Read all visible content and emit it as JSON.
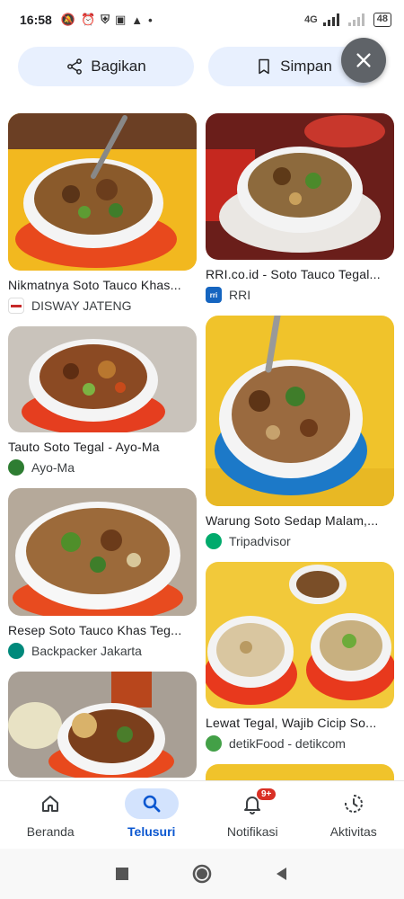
{
  "status_bar": {
    "time": "16:58",
    "network": "4G",
    "battery": "48"
  },
  "actions": {
    "share_label": "Bagikan",
    "save_label": "Simpan"
  },
  "results": {
    "left": [
      {
        "title": "Nikmatnya Soto Tauco Khas...",
        "source": "DISWAY JATENG",
        "favicon_color": "#c62828"
      },
      {
        "title": "Tauto Soto Tegal - Ayo-Ma",
        "source": "Ayo-Ma",
        "favicon_color": "#2e7d32"
      },
      {
        "title": "Resep Soto Tauco Khas Teg...",
        "source": "Backpacker Jakarta",
        "favicon_color": "#00897b"
      },
      {
        "title": "",
        "source": "",
        "favicon_color": "#ffffff"
      }
    ],
    "right": [
      {
        "title": "RRI.co.id - Soto Tauco Tegal...",
        "source": "RRI",
        "favicon_color": "#1565c0"
      },
      {
        "title": "Warung Soto Sedap Malam,...",
        "source": "Tripadvisor",
        "favicon_color": "#00aa6c"
      },
      {
        "title": "Lewat Tegal, Wajib Cicip So...",
        "source": "detikFood - detikcom",
        "favicon_color": "#43a047"
      }
    ]
  },
  "bottom_nav": {
    "items": [
      {
        "label": "Beranda",
        "icon": "home-icon"
      },
      {
        "label": "Telusuri",
        "icon": "search-icon"
      },
      {
        "label": "Notifikasi",
        "icon": "bell-icon",
        "badge": "9+"
      },
      {
        "label": "Aktivitas",
        "icon": "history-icon"
      }
    ]
  },
  "colors": {
    "accent": "#0b57d0",
    "chip_bg": "#e8f0fe",
    "active_pill": "#d3e3fd"
  }
}
